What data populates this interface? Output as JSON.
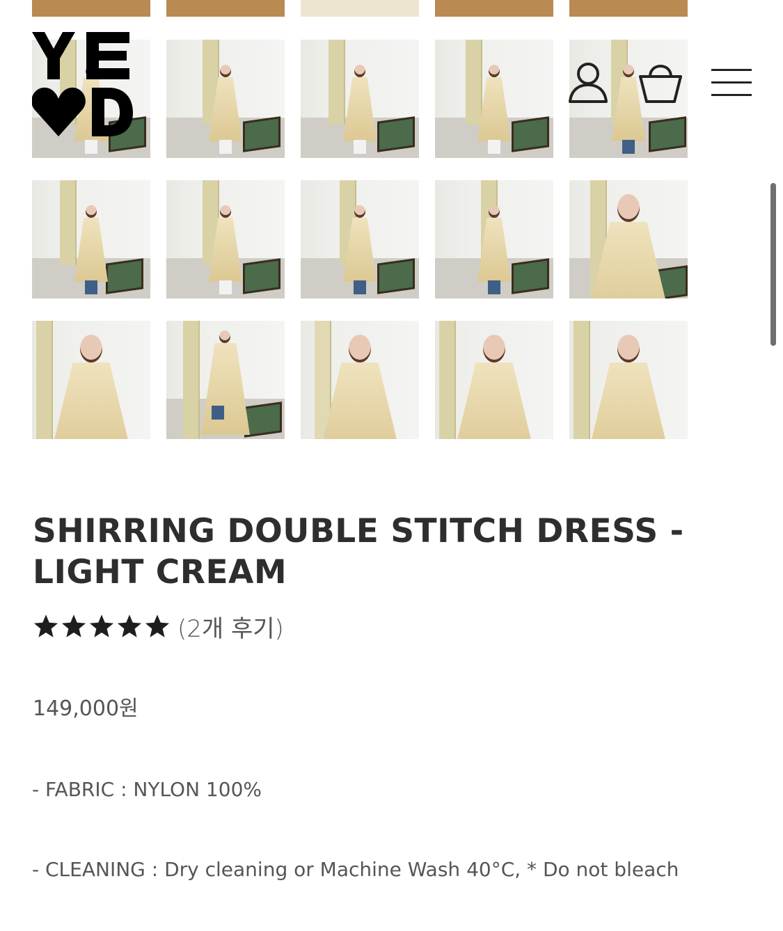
{
  "header": {
    "logo_text": "YE D",
    "account_icon": "user-icon",
    "cart_icon": "shopping-basket-icon",
    "menu_icon": "hamburger-menu-icon"
  },
  "gallery": {
    "thumbnail_count": 20,
    "accent_colors": {
      "dress": "#e9dcb5",
      "denim": "#3f5f86",
      "floor": "#cfcdc6"
    }
  },
  "product": {
    "title": "SHIRRING DOUBLE STITCH DRESS - LIGHT CREAM",
    "rating_stars": 5,
    "review_count_text": "(2개 후기)",
    "price": "149,000원",
    "fabric": "- FABRIC : NYLON 100%",
    "cleaning": "- CLEANING : Dry cleaning or Machine Wash 40°C, * Do not bleach"
  }
}
